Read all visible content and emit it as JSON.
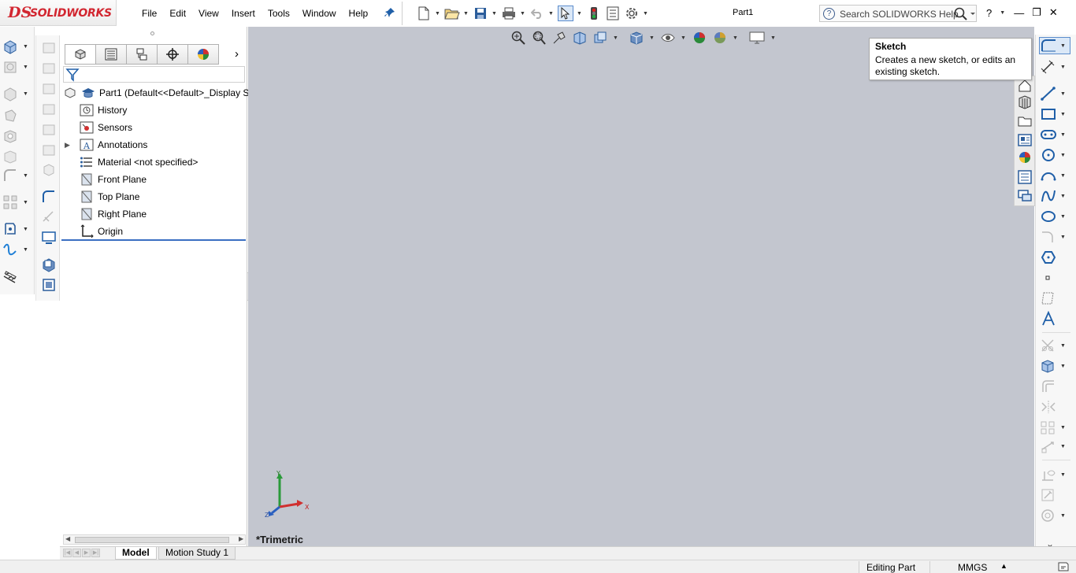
{
  "app": {
    "logo_prefix": "DS",
    "logo_text": "SOLIDWORKS",
    "document_title": "Part1"
  },
  "menu": [
    "File",
    "Edit",
    "View",
    "Insert",
    "Tools",
    "Window",
    "Help"
  ],
  "search": {
    "placeholder": "Search SOLIDWORKS Help",
    "help_glyph": "?"
  },
  "window_controls": {
    "help": "?",
    "minimize": "—",
    "restore": "❐",
    "close": "✕"
  },
  "feature_tree": {
    "root": "Part1  (Default<<Default>_Display S",
    "items": [
      {
        "label": "History",
        "icon": "history-icon",
        "expandable": false
      },
      {
        "label": "Sensors",
        "icon": "sensors-icon",
        "expandable": false
      },
      {
        "label": "Annotations",
        "icon": "annotations-icon",
        "expandable": true
      },
      {
        "label": "Material <not specified>",
        "icon": "material-icon",
        "expandable": false
      },
      {
        "label": "Front Plane",
        "icon": "plane-icon",
        "expandable": false
      },
      {
        "label": "Top Plane",
        "icon": "plane-icon",
        "expandable": false
      },
      {
        "label": "Right Plane",
        "icon": "plane-icon",
        "expandable": false
      },
      {
        "label": "Origin",
        "icon": "origin-icon",
        "expandable": false
      }
    ]
  },
  "viewport": {
    "view_label": "*Trimetric",
    "triad": {
      "x": "X",
      "y": "Y",
      "z": "Z"
    }
  },
  "tooltip": {
    "title": "Sketch",
    "description": "Creates a new sketch, or edits an existing sketch."
  },
  "bottom_tabs": {
    "model": "Model",
    "motion_study": "Motion Study 1"
  },
  "status_bar": {
    "mode": "Editing Part",
    "units": "MMGS",
    "units_arrow": "▲"
  },
  "colors": {
    "viewport_bg": "#c3c6cf",
    "accent_blue": "#1f5fa8",
    "logo_red": "#d22630",
    "selection_blue": "#3a6fc2"
  }
}
